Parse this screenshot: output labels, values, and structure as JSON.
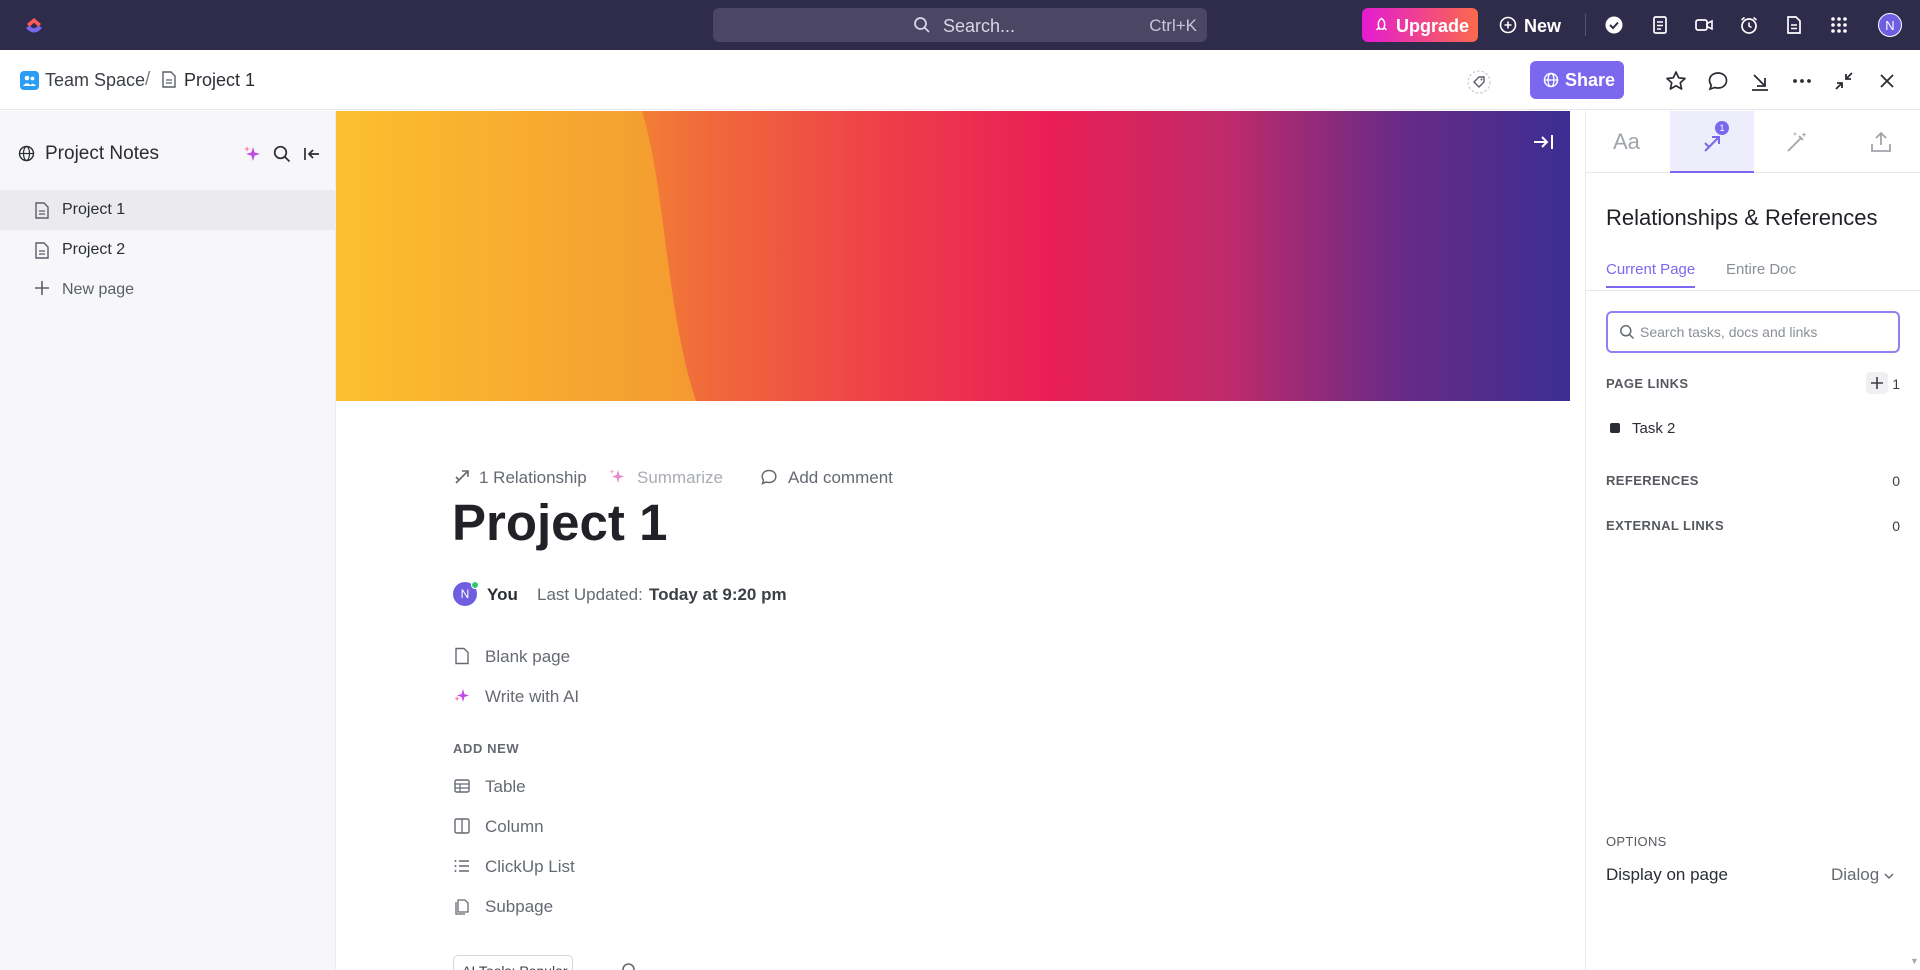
{
  "topbar": {
    "search_placeholder": "Search...",
    "search_shortcut": "Ctrl+K",
    "upgrade_label": "Upgrade",
    "new_label": "New",
    "avatar_initial": "N",
    "icons": [
      "check-circle-icon",
      "notepad-icon",
      "video-icon",
      "alarm-icon",
      "doc-icon",
      "apps-grid-icon"
    ]
  },
  "breadcrumb": {
    "space": "Team Space",
    "separator": "/",
    "page": "Project 1",
    "share_label": "Share"
  },
  "sidebar": {
    "title": "Project Notes",
    "items": [
      {
        "label": "Project 1",
        "active": true
      },
      {
        "label": "Project 2",
        "active": false
      }
    ],
    "new_page_label": "New page"
  },
  "doc": {
    "relationship_label": "1  Relationship",
    "summarize_label": "Summarize",
    "add_comment_label": "Add comment",
    "title": "Project 1",
    "author_initial": "N",
    "author_name": "You",
    "last_updated_label": "Last Updated:",
    "last_updated_value": "Today at 9:20 pm",
    "start_options": [
      "Blank page",
      "Write with AI"
    ],
    "add_new_heading": "ADD NEW",
    "add_new_items": [
      "Table",
      "Column",
      "ClickUp List",
      "Subpage"
    ],
    "ai_tools_label": "AI Tools: Popular"
  },
  "right_panel": {
    "tab_text_label": "Aa",
    "relationship_badge": "1",
    "title": "Relationships & References",
    "subtabs": [
      "Current Page",
      "Entire Doc"
    ],
    "search_placeholder": "Search tasks, docs and links",
    "page_links_label": "PAGE LINKS",
    "page_links_count": "1",
    "page_links": [
      "Task 2"
    ],
    "references_label": "REFERENCES",
    "references_count": "0",
    "external_links_label": "EXTERNAL LINKS",
    "external_links_count": "0",
    "options_label": "OPTIONS",
    "display_label": "Display on page",
    "display_value": "Dialog"
  },
  "colors": {
    "topbar_bg": "#2f2b4a",
    "accent": "#7b68ee",
    "upgrade_gradient_start": "#e41bd2",
    "upgrade_gradient_end": "#fa6a4b"
  }
}
